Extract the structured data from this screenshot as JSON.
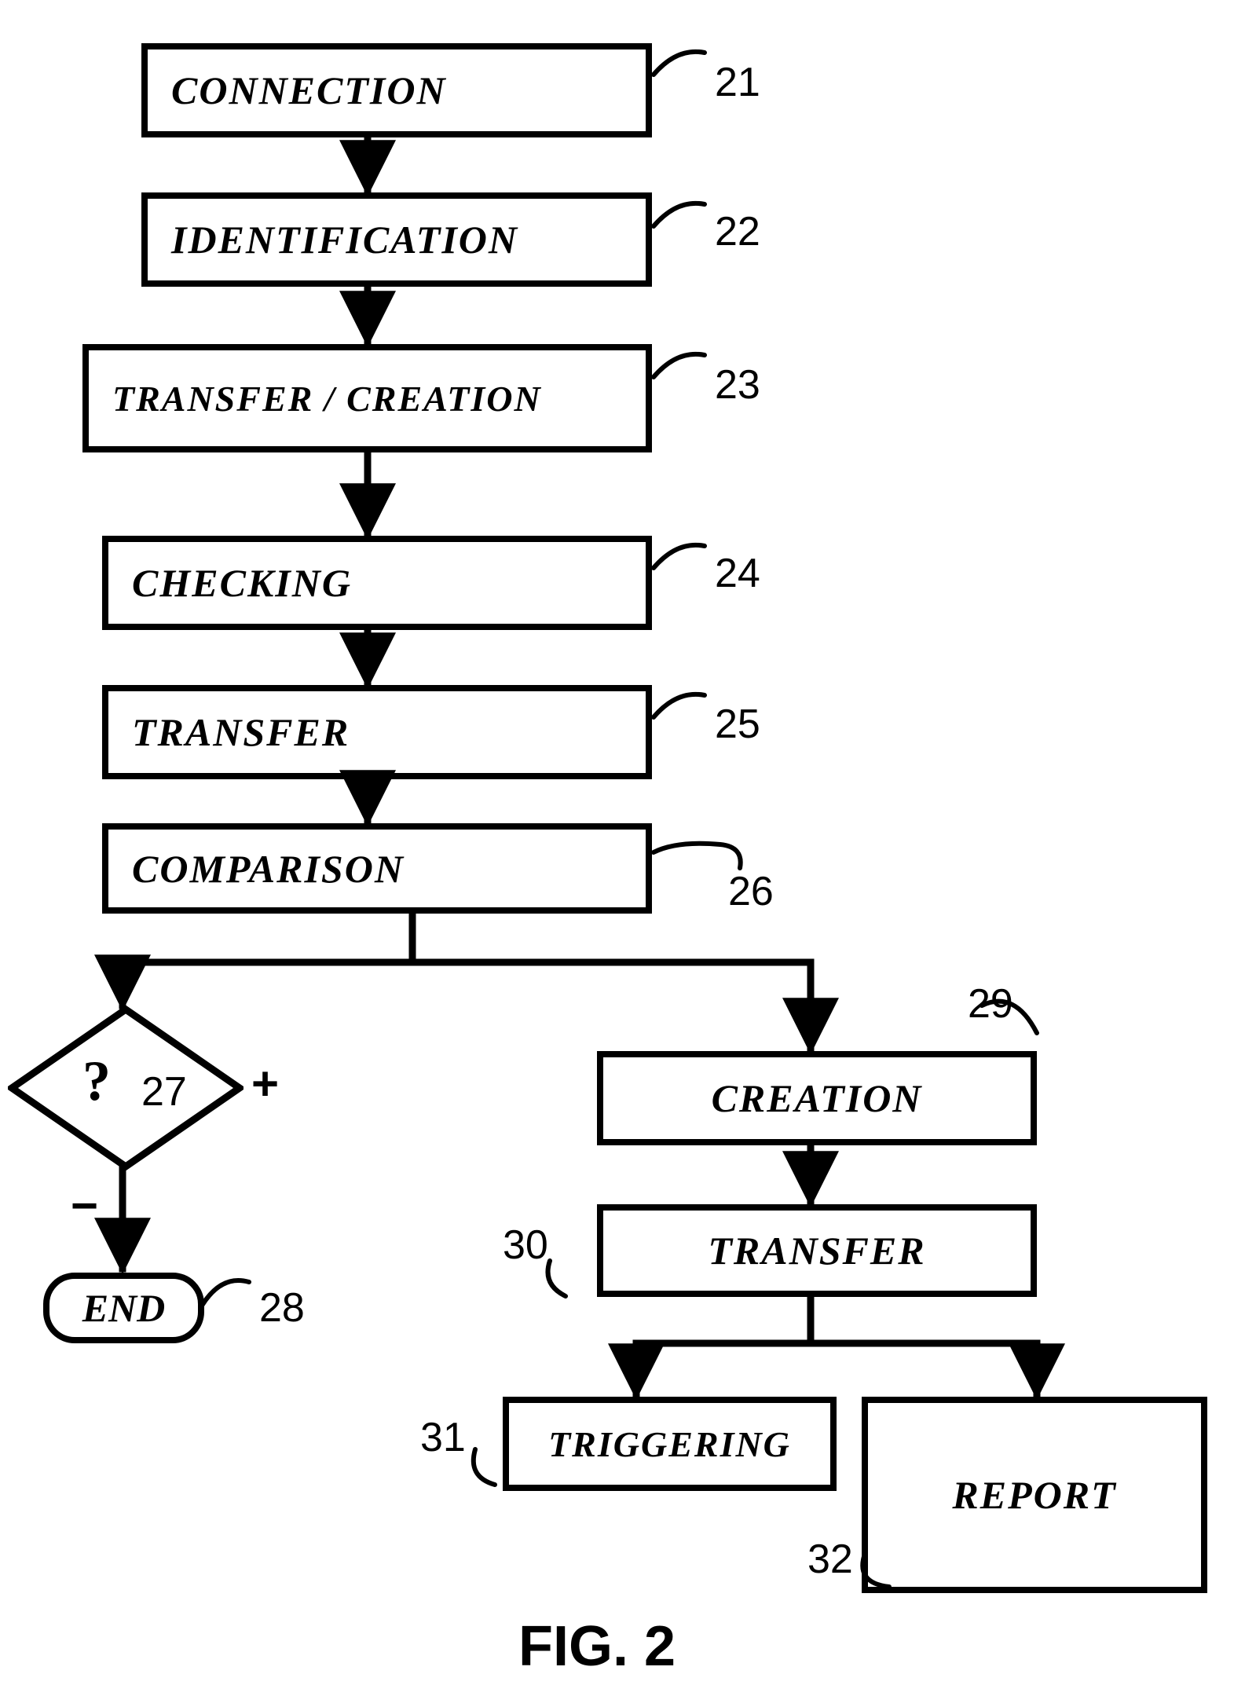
{
  "nodes": {
    "n21": {
      "label": "CONNECTION",
      "ref": "21"
    },
    "n22": {
      "label": "IDENTIFICATION",
      "ref": "22"
    },
    "n23": {
      "label": "TRANSFER / CREATION",
      "ref": "23"
    },
    "n24": {
      "label": "CHECKING",
      "ref": "24"
    },
    "n25": {
      "label": "TRANSFER",
      "ref": "25"
    },
    "n26": {
      "label": "COMPARISON",
      "ref": "26"
    },
    "n27": {
      "label": "?",
      "ref": "27"
    },
    "n28": {
      "label": "END",
      "ref": "28"
    },
    "n29": {
      "label": "CREATION",
      "ref": "29"
    },
    "n30": {
      "label": "TRANSFER",
      "ref": "30"
    },
    "n31": {
      "label": "TRIGGERING",
      "ref": "31"
    },
    "n32": {
      "label": "REPORT",
      "ref": "32"
    }
  },
  "decision": {
    "plus": "+",
    "minus": "−"
  },
  "figure": "FIG. 2"
}
